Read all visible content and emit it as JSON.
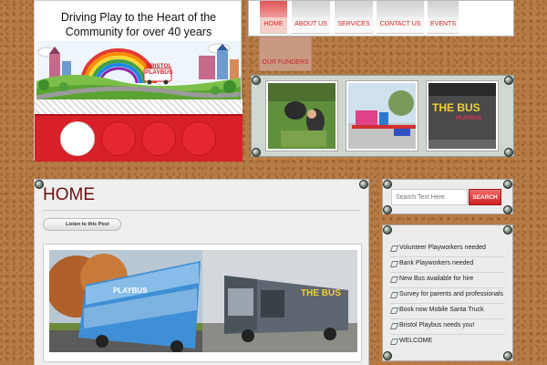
{
  "header": {
    "tagline": "Driving Play to the Heart of the Community for over 40 years",
    "logo_text_line1": "BRISTOL",
    "logo_text_line2": "PLAYBUS",
    "slider": {
      "dot_count": 4,
      "active_index": 0
    }
  },
  "nav": {
    "items": [
      {
        "label": "HOME",
        "active": true
      },
      {
        "label": "ABOUT US",
        "active": false
      },
      {
        "label": "SERVICES",
        "active": false
      },
      {
        "label": "CONTACT US",
        "active": false
      },
      {
        "label": "EVENTS",
        "active": false
      }
    ],
    "funders": "OUR FUNDERS"
  },
  "gallery": {
    "thumb3_text_line1": "THE BUS",
    "thumb3_text_line2": "PLAYBUS"
  },
  "main": {
    "title": "HOME",
    "listen_label": "Listen to this Post",
    "photo_bus1_text": "PLAYBUS",
    "photo_bus2_text": "THE BUS"
  },
  "search": {
    "placeholder": "Search Text Here",
    "button_label": "SEARCH"
  },
  "posts": [
    "Volunteer Playworkers needed",
    "Bank Playworkers needed",
    "New Bus available for hire",
    "Survey for parents and professionals",
    "Book now Mobile Santa Truck",
    "Bristol Playbus needs you!",
    "WELCOME"
  ],
  "colors": {
    "cork": "#b67a45",
    "accent_red": "#d8202a",
    "title_red": "#6b1111",
    "nav_text": "#d52a2a"
  }
}
